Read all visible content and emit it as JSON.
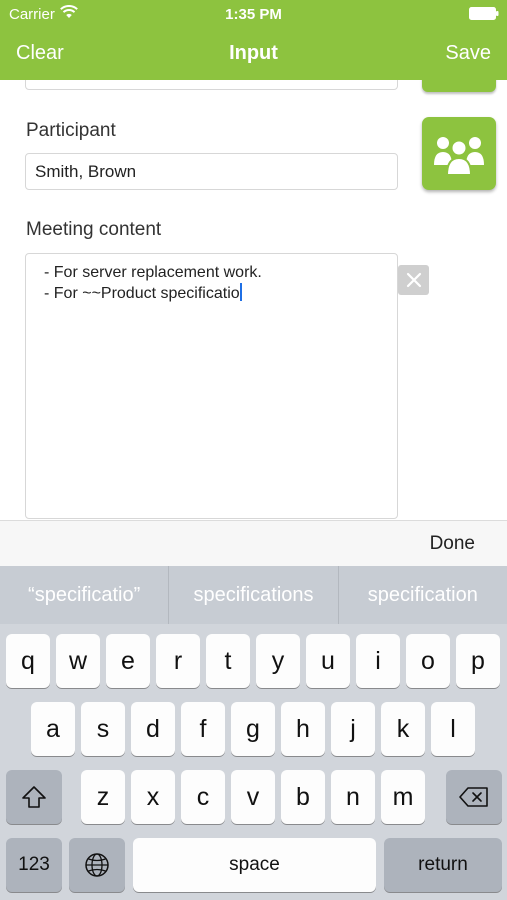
{
  "status_bar": {
    "carrier": "Carrier",
    "time": "1:35 PM"
  },
  "nav": {
    "left": "Clear",
    "title": "Input",
    "right": "Save"
  },
  "form": {
    "participant_label": "Participant",
    "participant_value": "Smith, Brown",
    "content_label": "Meeting content",
    "content_lines": [
      "- For server replacement work.",
      "- For ~~Product specificatio"
    ]
  },
  "accessory": {
    "done": "Done"
  },
  "keyboard": {
    "suggestions": [
      "“specificatio”",
      "specifications",
      "specification"
    ],
    "row1": [
      "q",
      "w",
      "e",
      "r",
      "t",
      "y",
      "u",
      "i",
      "o",
      "p"
    ],
    "row2": [
      "a",
      "s",
      "d",
      "f",
      "g",
      "h",
      "j",
      "k",
      "l"
    ],
    "row3": [
      "z",
      "x",
      "c",
      "v",
      "b",
      "n",
      "m"
    ],
    "numbers": "123",
    "space": "space",
    "return": "return",
    "icons": {
      "shift": "shift-icon",
      "delete": "delete-icon",
      "globe": "globe-icon"
    }
  },
  "colors": {
    "accent": "#8dc33f",
    "keyboard_bg": "#d1d5db",
    "caret": "#1f6fe5"
  }
}
